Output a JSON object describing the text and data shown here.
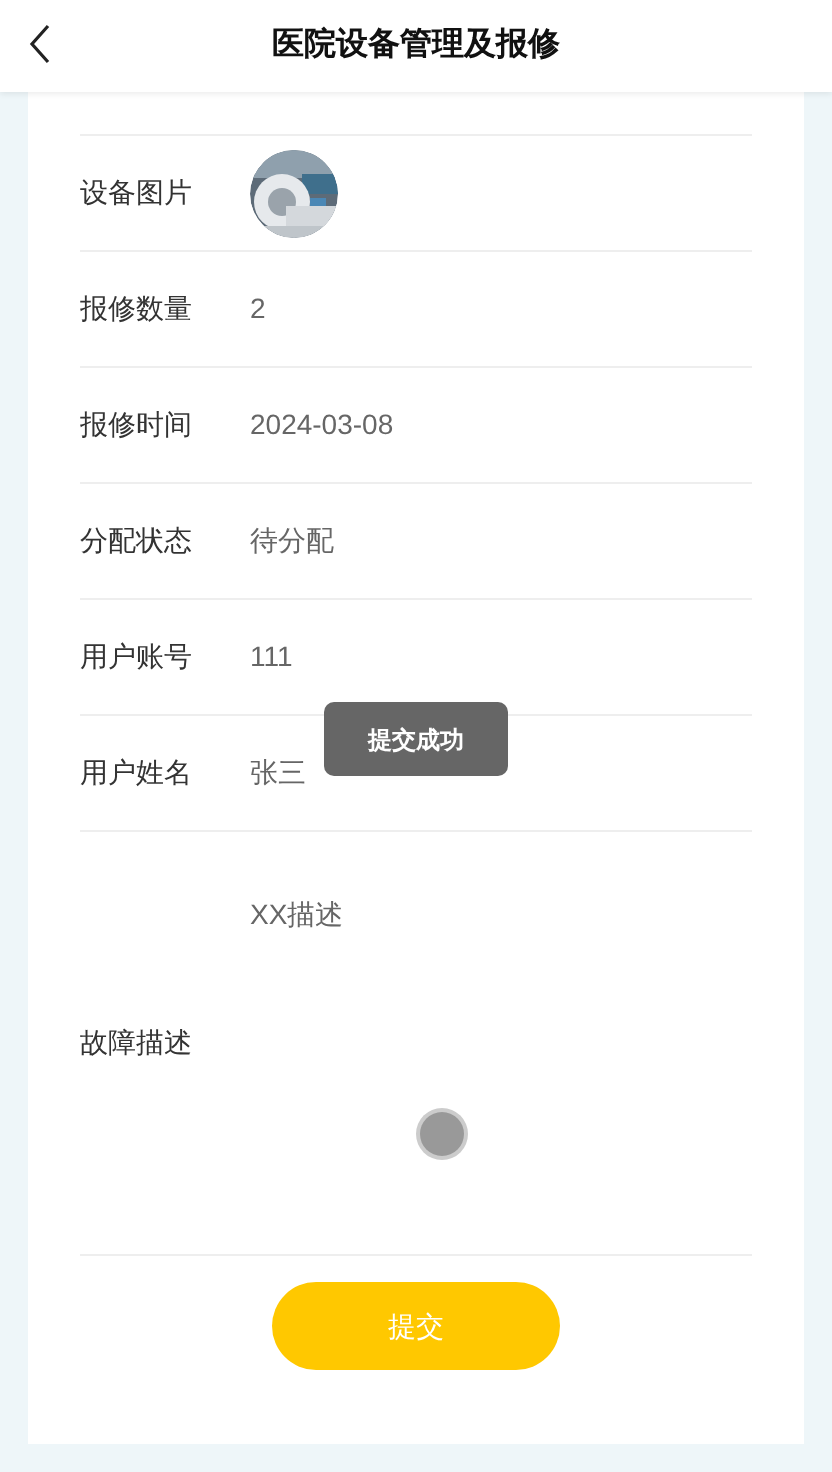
{
  "header": {
    "title": "医院设备管理及报修"
  },
  "fields": [
    {
      "label": "设备图片"
    },
    {
      "kind": "text",
      "label": "报修数量",
      "value": "2"
    },
    {
      "kind": "text",
      "label": "报修时间",
      "value": "2024-03-08"
    },
    {
      "kind": "text",
      "label": "分配状态",
      "value": "待分配"
    },
    {
      "kind": "text",
      "label": "用户账号",
      "value": "111"
    },
    {
      "kind": "text",
      "label": "用户姓名",
      "value": "张三"
    },
    {
      "kind": "textarea",
      "label": "故障描述",
      "value": "XX描述",
      "loading": true
    }
  ],
  "submit_button": "提交",
  "toast": "提交成功"
}
